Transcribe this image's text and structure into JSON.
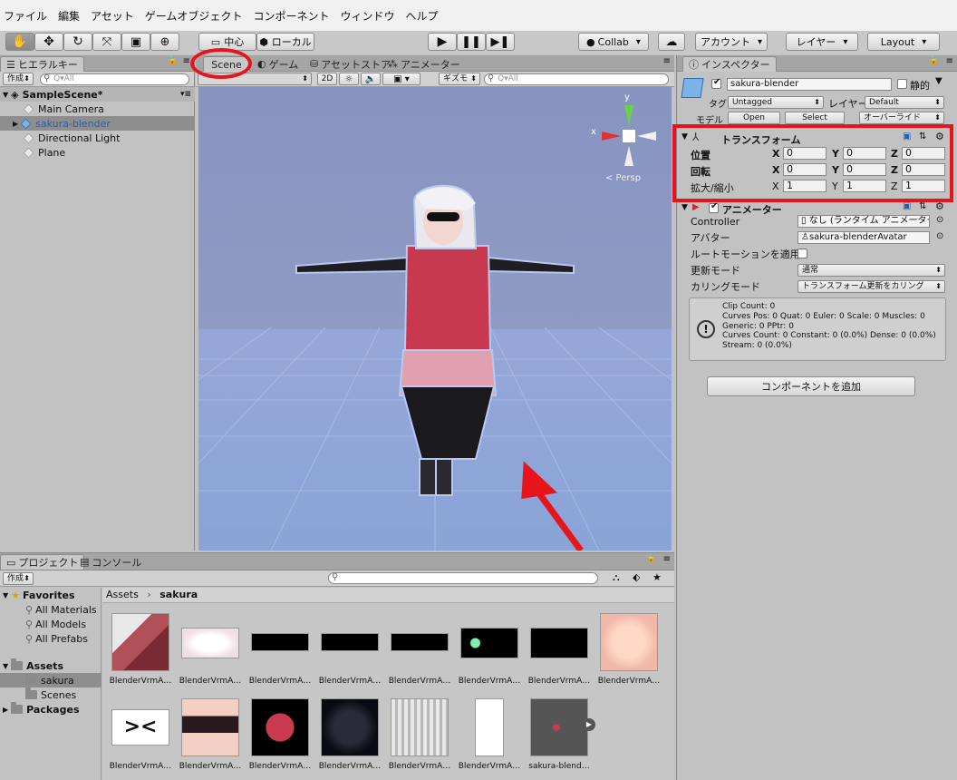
{
  "menu": [
    "ファイル",
    "編集",
    "アセット",
    "ゲームオブジェクト",
    "コンポーネント",
    "ウィンドウ",
    "ヘルプ"
  ],
  "toolbar": {
    "pivot": "中心",
    "space": "ローカル",
    "collab": "Collab",
    "account": "アカウント",
    "layers": "レイヤー",
    "layout": "Layout"
  },
  "hierarchy": {
    "tab": "ヒエラルキー",
    "create": "作成",
    "search_placeholder": "Q▾All",
    "scene": "SampleScene*",
    "items": [
      "Main Camera",
      "sakura-blender",
      "Directional Light",
      "Plane"
    ]
  },
  "scene_tabs": {
    "scene": "Scene",
    "game": "ゲーム",
    "store": "アセットストア",
    "animator": "アニメーター",
    "mode_2d": "2D",
    "gizmos": "ギズモ",
    "search_placeholder": "Q▾All",
    "persp": "< Persp",
    "axis_y": "y",
    "axis_x": "x"
  },
  "inspector": {
    "tab": "インスペクター",
    "object_name": "sakura-blender",
    "static": "静的",
    "tag_label": "タグ",
    "tag_value": "Untagged",
    "layer_label": "レイヤー",
    "layer_value": "Default",
    "model_label": "モデル",
    "open": "Open",
    "select": "Select",
    "override": "オーバーライド",
    "transform": {
      "title": "トランスフォーム",
      "position": "位置",
      "rotation": "回転",
      "scale": "拡大/縮小",
      "px": "0",
      "py": "0",
      "pz": "0",
      "rx": "0",
      "ry": "0",
      "rz": "0",
      "sx": "1",
      "sy": "1",
      "sz": "1"
    },
    "animator": {
      "title": "アニメーター",
      "controller_label": "Controller",
      "controller_value": "なし (ランタイム アニメーター コ",
      "avatar_label": "アバター",
      "avatar_value": "sakura-blenderAvatar",
      "root_motion": "ルートモーションを適用",
      "update_label": "更新モード",
      "update_value": "通常",
      "culling_label": "カリングモード",
      "culling_value": "トランスフォーム更新をカリング",
      "info": [
        "Clip Count: 0",
        "Curves Pos: 0 Quat: 0 Euler: 0 Scale: 0 Muscles: 0",
        "Generic: 0 PPtr: 0",
        "Curves Count: 0 Constant: 0 (0.0%) Dense: 0 (0.0%)",
        "Stream: 0 (0.0%)"
      ]
    },
    "add_component": "コンポーネントを追加"
  },
  "project": {
    "tab": "プロジェクト",
    "console_tab": "コンソール",
    "create": "作成",
    "favorites": "Favorites",
    "fav_items": [
      "All Materials",
      "All Models",
      "All Prefabs"
    ],
    "assets": "Assets",
    "asset_folders": [
      "sakura",
      "Scenes"
    ],
    "packages": "Packages",
    "breadcrumb_root": "Assets",
    "breadcrumb_current": "sakura",
    "asset_labels": [
      "BlenderVrmA…",
      "BlenderVrmA…",
      "BlenderVrmA…",
      "BlenderVrmA…",
      "BlenderVrmA…",
      "BlenderVrmA…",
      "BlenderVrmA…",
      "BlenderVrmA…",
      "BlenderVrmA…",
      "BlenderVrmA…",
      "BlenderVrmA…",
      "BlenderVrmA…",
      "BlenderVrmA…",
      "BlenderVrmA…",
      "sakura-blend…"
    ]
  },
  "colors": {
    "annotation_red": "#e8141c",
    "scene_sky": "#8c9cc4",
    "scene_floor": "#8fa8d8"
  }
}
